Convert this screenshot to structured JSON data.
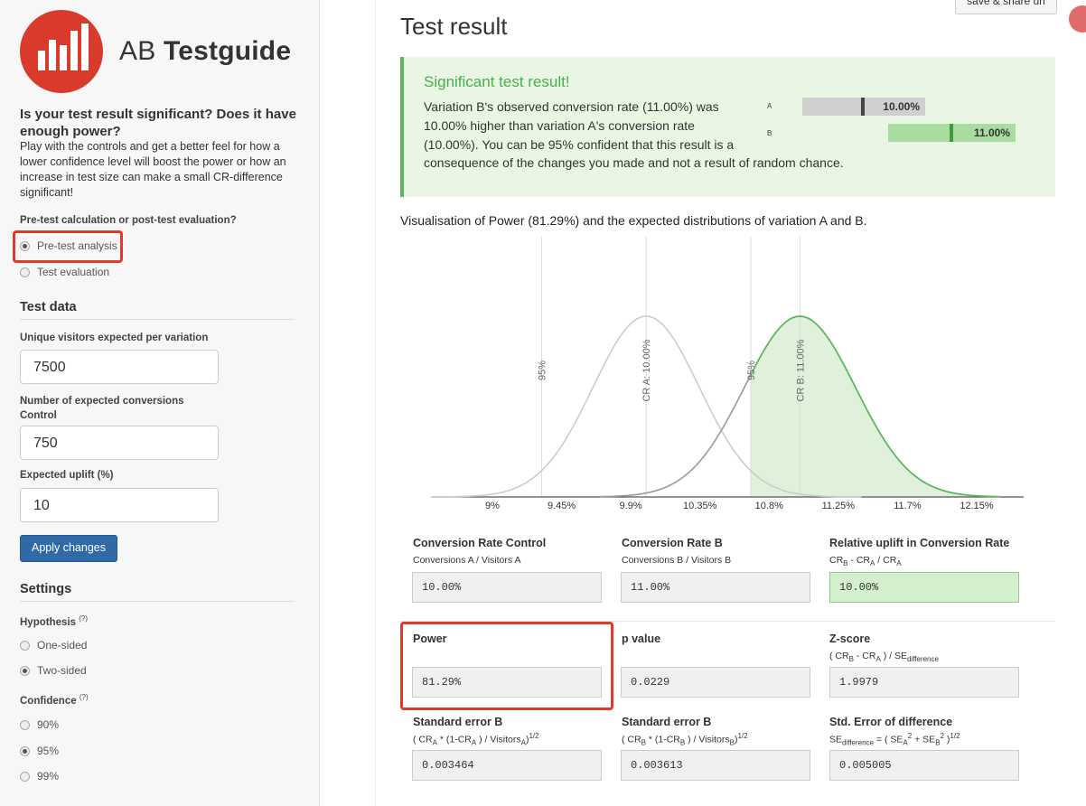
{
  "brand": {
    "name_light": "AB ",
    "name_bold": "Testguide"
  },
  "intro": {
    "title": "Is your test result significant? Does it have enough power?",
    "text": "Play with the controls and get a better feel for how a lower confidence level will boost the power or how an increase in test size can make a small CR-difference significant!"
  },
  "mode": {
    "question": "Pre-test calculation or post-test evaluation?",
    "options": [
      {
        "label": "Pre-test analysis",
        "selected": true
      },
      {
        "label": "Test evaluation",
        "selected": false
      }
    ]
  },
  "test_data": {
    "heading": "Test data",
    "visitors_label": "Unique visitors expected per variation",
    "visitors_value": "7500",
    "conversions_label": "Number of expected conversions Control",
    "conversions_value": "750",
    "uplift_label": "Expected uplift (%)",
    "uplift_value": "10",
    "apply_label": "Apply changes"
  },
  "settings": {
    "heading": "Settings",
    "hypothesis_label": "Hypothesis",
    "hypothesis_help": "(?)",
    "hypothesis_options": [
      {
        "label": "One-sided",
        "selected": false
      },
      {
        "label": "Two-sided",
        "selected": true
      }
    ],
    "confidence_label": "Confidence",
    "confidence_help": "(?)",
    "confidence_options": [
      {
        "label": "90%",
        "selected": false
      },
      {
        "label": "95%",
        "selected": true
      },
      {
        "label": "99%",
        "selected": false
      }
    ]
  },
  "header": {
    "share_label": "save & share url",
    "title": "Test result"
  },
  "alert": {
    "title": "Significant test result!",
    "body": "Variation B's observed conversion rate (11.00%) was 10.00% higher than variation A's conversion rate (10.00%). You can be 95% confident that this result is a",
    "tail": "consequence of the changes you made and not a result of random chance.",
    "bar_a_label": "A",
    "bar_a_value": "10.00%",
    "bar_b_label": "B",
    "bar_b_value": "11.00%"
  },
  "visualisation_title": "Visualisation of Power (81.29%) and the expected distributions of variation A and B.",
  "chart_data": {
    "type": "area",
    "x_ticks": [
      "9%",
      "9.45%",
      "9.9%",
      "10.35%",
      "10.8%",
      "11.25%",
      "11.7%",
      "12.15%"
    ],
    "x_tick_values": [
      9.0,
      9.45,
      9.9,
      10.35,
      10.8,
      11.25,
      11.7,
      12.15
    ],
    "series": [
      {
        "mean": 10.0,
        "sd": 0.3464,
        "color": "#cccccc"
      },
      {
        "mean": 11.0,
        "sd": 0.3613,
        "color": "#5cb85c"
      }
    ],
    "shaded_power_from": 10.68,
    "vlines": [
      {
        "x": 9.32,
        "label": "95%"
      },
      {
        "x": 10.0,
        "label": "CR A: 10.00%"
      },
      {
        "x": 10.68,
        "label": "95%"
      },
      {
        "x": 11.0,
        "label": "CR B: 11.00%"
      }
    ]
  },
  "metrics": {
    "cr_control": {
      "title": "Conversion Rate Control",
      "sub": "Conversions A / Visitors A",
      "value": "10.00%"
    },
    "cr_b": {
      "title": "Conversion Rate B",
      "sub": "Conversions B / Visitors B",
      "value": "11.00%"
    },
    "uplift": {
      "title": "Relative uplift in Conversion Rate",
      "value": "10.00%"
    },
    "power": {
      "title": "Power",
      "value": "81.29%"
    },
    "pvalue": {
      "title": "p value",
      "value": "0.0229"
    },
    "zscore": {
      "title": "Z-score",
      "value": "1.9979"
    },
    "se_a": {
      "title": "Standard error B",
      "value": "0.003464"
    },
    "se_b": {
      "title": "Standard error B",
      "value": "0.003613"
    },
    "se_diff": {
      "title": "Std. Error of difference",
      "value": "0.005005"
    }
  }
}
